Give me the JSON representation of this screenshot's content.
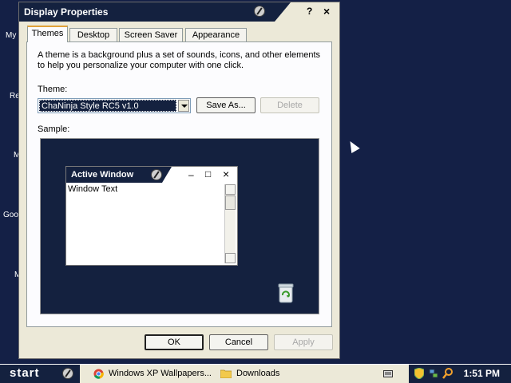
{
  "desktop": {
    "icon_labels": [
      "My",
      "Re",
      "M",
      "Goo",
      "M"
    ]
  },
  "dialog": {
    "title": "Display Properties",
    "help_label": "?",
    "close_label": "×",
    "tabs": [
      "Themes",
      "Desktop",
      "Screen Saver",
      "Appearance"
    ],
    "active_tab": "Themes",
    "description": "A theme is a background plus a set of sounds, icons, and other elements to help you personalize your computer with one click.",
    "theme_label": "Theme:",
    "theme_value": "ChaNinja Style RC5 v1.0",
    "save_as_label": "Save As...",
    "delete_label": "Delete",
    "sample_label": "Sample:",
    "preview": {
      "window_title": "Active Window",
      "minimize": "–",
      "maximize": "□",
      "close": "×",
      "window_text": "Window Text"
    },
    "ok_label": "OK",
    "cancel_label": "Cancel",
    "apply_label": "Apply"
  },
  "taskbar": {
    "start_label": "start",
    "tasks": [
      {
        "label": "Windows XP Wallpapers...",
        "icon": "chrome-icon"
      },
      {
        "label": "Downloads",
        "icon": "folder-icon"
      }
    ],
    "clock": "1:51 PM"
  },
  "colors": {
    "desktop_bg": "#142046",
    "titlebar": "#14213f",
    "dialog_bg": "#ece9d8"
  }
}
